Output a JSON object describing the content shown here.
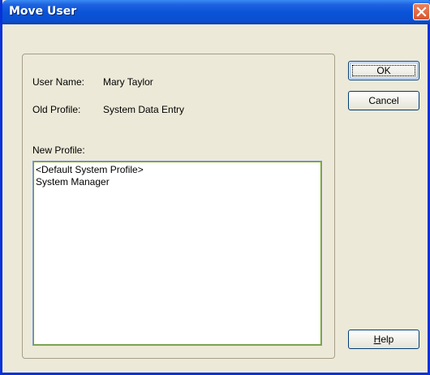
{
  "window": {
    "title": "Move User"
  },
  "fields": {
    "user_name_label": "User Name:",
    "user_name_value": "Mary Taylor",
    "old_profile_label": "Old Profile:",
    "old_profile_value": "System Data Entry",
    "new_profile_label": "New Profile:"
  },
  "profiles": [
    "<Default System Profile>",
    "System Manager"
  ],
  "buttons": {
    "ok": "OK",
    "cancel": "Cancel",
    "help_accel": "H",
    "help_rest": "elp"
  },
  "icons": {
    "close": "close-icon"
  },
  "colors": {
    "titlebar": "#0a53d8",
    "close": "#d9542c",
    "dialog_bg": "#ece9d8"
  }
}
